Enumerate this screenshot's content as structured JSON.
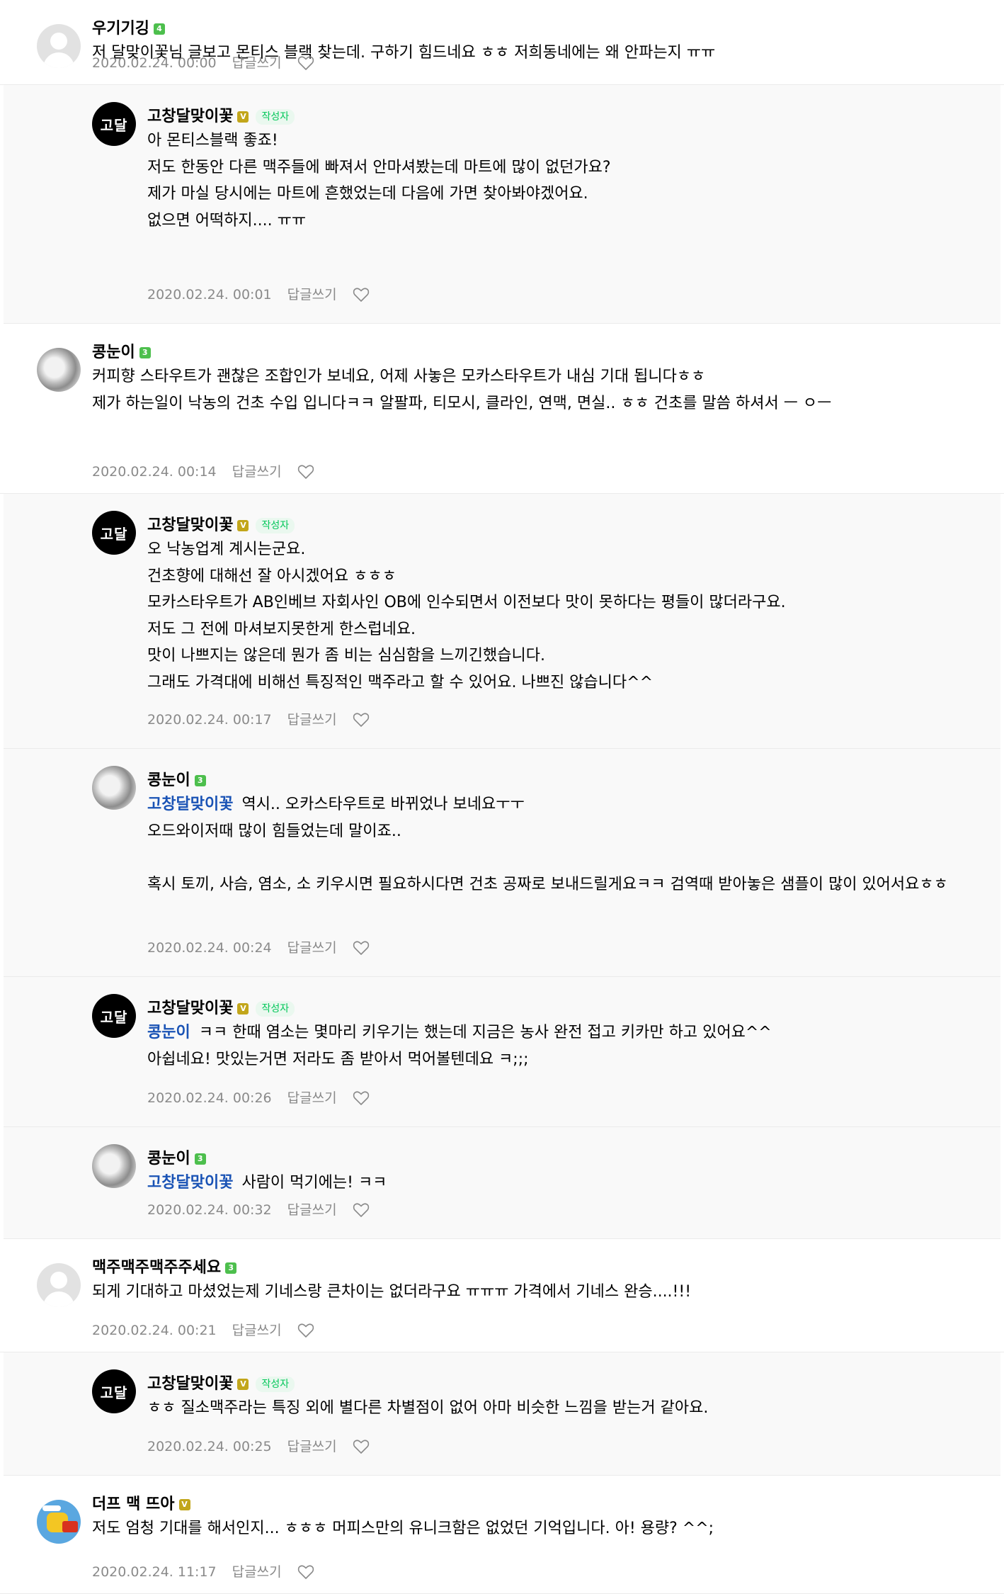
{
  "ui": {
    "reply_label": "답글쓰기",
    "author_tag": "작성자",
    "colors": {
      "mention": "#1a53b5",
      "meta": "#8a8a8a",
      "badge_green": "#4dbf4d",
      "badge_gold": "#c2a61b",
      "author_tag": "#03c75a"
    }
  },
  "comments": [
    {
      "id": "c1",
      "type": "top",
      "author": "우기기깅",
      "level": "4",
      "avatar": "default",
      "lines": [
        "저 달맞이꽃님 글보고 몬티스 블랙 찾는데. 구하기 힘드네요 ㅎㅎ 저희동네에는 왜 안파는지 ㅠㅠ"
      ],
      "date": "2020.02.24. 00:00"
    },
    {
      "id": "c2",
      "type": "reply",
      "author": "고창달맞이꽃",
      "level": "V",
      "avatar": "logo",
      "avatar_text": "고달",
      "is_writer": true,
      "lines": [
        "아 몬티스블랙 좋죠!",
        "저도 한동안 다른 맥주들에 빠져서 안마셔봤는데 마트에 많이 없던가요?",
        "제가 마실 당시에는 마트에 흔했었는데 다음에 가면 찾아봐야겠어요.",
        "없으면 어떡하지.... ㅠㅠ"
      ],
      "date": "2020.02.24. 00:01"
    },
    {
      "id": "c3",
      "type": "top",
      "author": "콩눈이",
      "level": "3",
      "avatar": "snow",
      "lines": [
        "커피향 스타우트가 괜찮은 조합인가 보네요, 어제 사놓은 모카스타우트가 내심 기대 됩니다ㅎㅎ",
        "제가 하는일이 낙농의 건초 수입 입니다ㅋㅋ 알팔파, 티모시, 클라인, 연맥, 면실.. ㅎㅎ 건초를 말씀 하셔서 ㅡ ㅇㅡ"
      ],
      "date": "2020.02.24. 00:14"
    },
    {
      "id": "c4",
      "type": "reply",
      "author": "고창달맞이꽃",
      "level": "V",
      "avatar": "logo",
      "avatar_text": "고달",
      "is_writer": true,
      "lines": [
        "오 낙농업계 계시는군요.",
        "건초향에 대해선 잘 아시겠어요 ㅎㅎㅎ",
        "모카스타우트가 AB인베브 자회사인 OB에 인수되면서 이전보다 맛이 못하다는 평들이 많더라구요.",
        "저도 그 전에 마셔보지못한게 한스럽네요.",
        "맛이 나쁘지는 않은데 뭔가 좀 비는 심심함을 느끼긴했습니다.",
        "그래도 가격대에 비해선 특징적인 맥주라고 할 수 있어요. 나쁘진 않습니다^^"
      ],
      "date": "2020.02.24. 00:17"
    },
    {
      "id": "c5",
      "type": "reply",
      "author": "콩눈이",
      "level": "3",
      "avatar": "snow",
      "mention": "고창달맞이꽃",
      "lines": [
        "역시.. 오카스타우트로 바뀌었나 보네요ㅜㅜ",
        "오드와이저때 많이 힘들었는데 말이죠..",
        "",
        "혹시 토끼, 사슴, 염소, 소 키우시면 필요하시다면 건초 공짜로 보내드릴게요ㅋㅋ 검역때 받아놓은 샘플이 많이 있어서요ㅎㅎ"
      ],
      "date": "2020.02.24. 00:24"
    },
    {
      "id": "c6",
      "type": "reply",
      "author": "고창달맞이꽃",
      "level": "V",
      "avatar": "logo",
      "avatar_text": "고달",
      "is_writer": true,
      "mention": "콩눈이",
      "lines": [
        "ㅋㅋ 한때 염소는 몇마리 키우기는 했는데 지금은 농사 완전 접고 키카만 하고 있어요^^",
        "아쉽네요! 맛있는거면 저라도 좀 받아서 먹어볼텐데요 ㅋ;;;"
      ],
      "date": "2020.02.24. 00:26"
    },
    {
      "id": "c7",
      "type": "reply",
      "author": "콩눈이",
      "level": "3",
      "avatar": "snow",
      "mention": "고창달맞이꽃",
      "lines": [
        "사람이 먹기에는! ㅋㅋ"
      ],
      "date": "2020.02.24. 00:32"
    },
    {
      "id": "c8",
      "type": "top",
      "author": "맥주맥주맥주주세요",
      "level": "3",
      "avatar": "default",
      "lines": [
        "되게 기대하고 마셨었는제 기네스랑 큰차이는 없더라구요 ㅠㅠㅠ 가격에서 기네스 완승....!!!"
      ],
      "date": "2020.02.24. 00:21"
    },
    {
      "id": "c9",
      "type": "reply",
      "author": "고창달맞이꽃",
      "level": "V",
      "avatar": "logo",
      "avatar_text": "고달",
      "is_writer": true,
      "lines": [
        "ㅎㅎ 질소맥주라는 특징 외에 별다른 차별점이 없어 아마 비슷한 느낌을 받는거 같아요."
      ],
      "date": "2020.02.24. 00:25"
    },
    {
      "id": "c10",
      "type": "top",
      "author": "더프 맥 뜨아",
      "level": "V",
      "avatar": "cartoon",
      "lines": [
        "저도 엄청 기대를 해서인지... ㅎㅎㅎ 머피스만의 유니크함은 없었던 기억입니다. 아! 용량? ^^;"
      ],
      "date": "2020.02.24. 11:17"
    }
  ]
}
